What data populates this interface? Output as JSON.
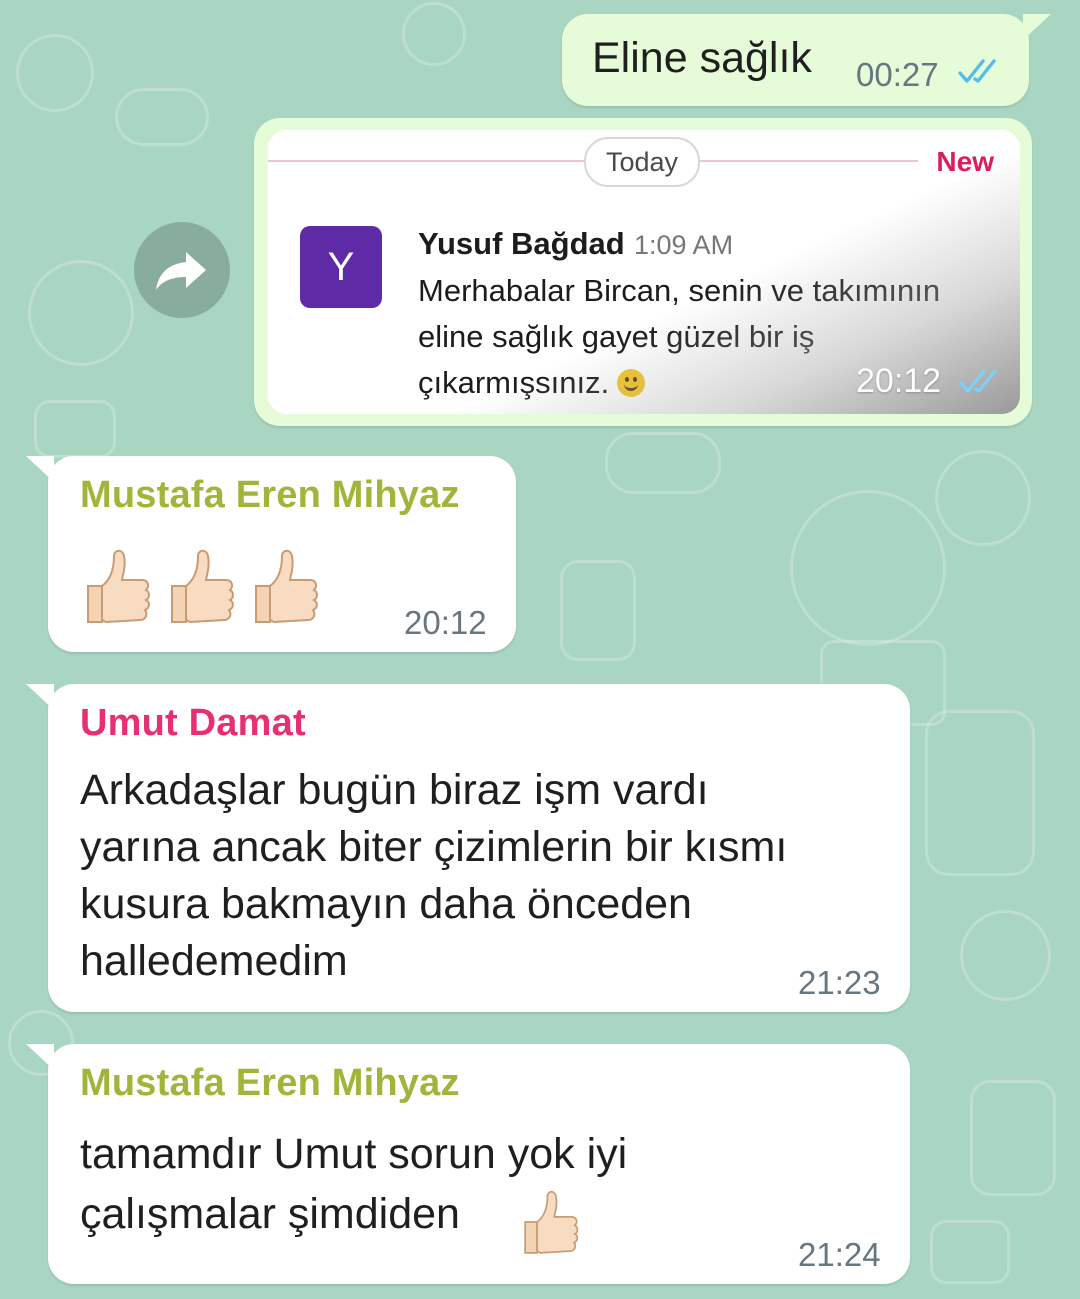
{
  "colors": {
    "wallpaper": "#a9d6c2",
    "outgoing_bubble": "#e6fbd7",
    "incoming_bubble": "#ffffff",
    "read_ticks": "#53bdeb",
    "sender_mustafa": "#9fb63b",
    "sender_umut": "#e82f74",
    "timestamp": "#667781",
    "slack_new": "#d91e5b",
    "slack_avatar": "#5f2aa6"
  },
  "messages": [
    {
      "direction": "outgoing",
      "text": "Eline sağlık",
      "time": "00:27",
      "status_icon": "double-check-read-icon"
    },
    {
      "direction": "outgoing",
      "type": "image",
      "time": "20:12",
      "status_icon": "double-check-read-icon",
      "forward_icon": "forward-arrow-icon",
      "screenshot": {
        "divider_label": "Today",
        "new_label": "New",
        "avatar_letter": "Y",
        "author": "Yusuf Bağdad",
        "author_time": "1:09 AM",
        "text": "Merhabalar Bircan, senin ve takımının\neline sağlık gayet güzel bir iş\nçıkarmışsınız.",
        "emoji": "slightly-smiling-face-icon"
      }
    },
    {
      "direction": "incoming",
      "sender": "Mustafa Eren Mihyaz",
      "content_icons": [
        "thumbs-up-icon",
        "thumbs-up-icon",
        "thumbs-up-icon"
      ],
      "time": "20:12"
    },
    {
      "direction": "incoming",
      "sender": "Umut Damat",
      "text": "Arkadaşlar bugün biraz işm vardı\nyarına ancak biter çizimlerin bir kısmı\nkusura bakmayın daha önceden\nhalledemedim",
      "time": "21:23"
    },
    {
      "direction": "incoming",
      "sender": "Mustafa Eren Mihyaz",
      "text": "tamamdır Umut sorun yok iyi\nçalışmalar şimdiden",
      "trailing_icon": "thumbs-up-icon",
      "time": "21:24"
    }
  ]
}
